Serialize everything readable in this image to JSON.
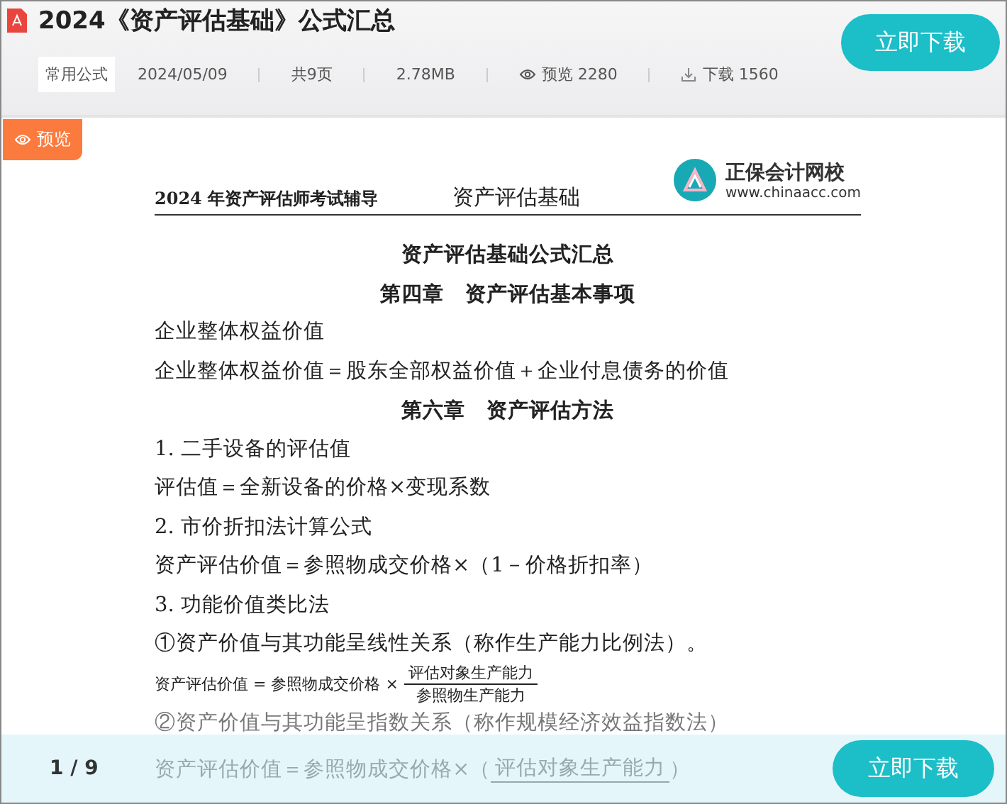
{
  "header": {
    "title": "2024《资产评估基础》公式汇总",
    "tag": "常用公式",
    "date": "2024/05/09",
    "pages": "共9页",
    "size": "2.78MB",
    "views": "预览 2280",
    "downloads": "下载 1560",
    "download_button": "立即下载"
  },
  "preview_badge": "预览",
  "document": {
    "header_left": "2024 年资产评估师考试辅导",
    "header_center": "资产评估基础",
    "logo": {
      "name": "正保会计网校",
      "url": "www.chinaacc.com"
    },
    "lines": [
      {
        "kind": "title",
        "text": "资产评估基础公式汇总"
      },
      {
        "kind": "title",
        "text": "第四章　资产评估基本事项"
      },
      {
        "kind": "text",
        "text": "企业整体权益价值"
      },
      {
        "kind": "text",
        "text": "企业整体权益价值＝股东全部权益价值＋企业付息债务的价值"
      },
      {
        "kind": "title",
        "text": "第六章　资产评估方法"
      },
      {
        "kind": "text",
        "text": "1. 二手设备的评估值"
      },
      {
        "kind": "text",
        "text": "评估值＝全新设备的价格×变现系数"
      },
      {
        "kind": "text",
        "text": "2. 市价折扣法计算公式"
      },
      {
        "kind": "text",
        "text": "资产评估价值＝参照物成交价格×（1－价格折扣率）"
      },
      {
        "kind": "text",
        "text": "3. 功能价值类比法"
      },
      {
        "kind": "text",
        "text": "①资产价值与其功能呈线性关系（称作生产能力比例法）。"
      },
      {
        "kind": "formula",
        "text": "资产评估价值 = 参照物成交价格 ×",
        "numerator": "评估对象生产能力",
        "denominator": "参照物生产能力"
      },
      {
        "kind": "text",
        "text": "②资产价值与其功能呈指数关系（称作规模经济效益指数法）"
      },
      {
        "kind": "cut",
        "text": "资产评估价值＝参照物成交价格×（",
        "numerator": "评估对象生产能力",
        "after": "）"
      }
    ]
  },
  "bottom_bar": {
    "page": "1 / 9",
    "download_button": "立即下载"
  }
}
